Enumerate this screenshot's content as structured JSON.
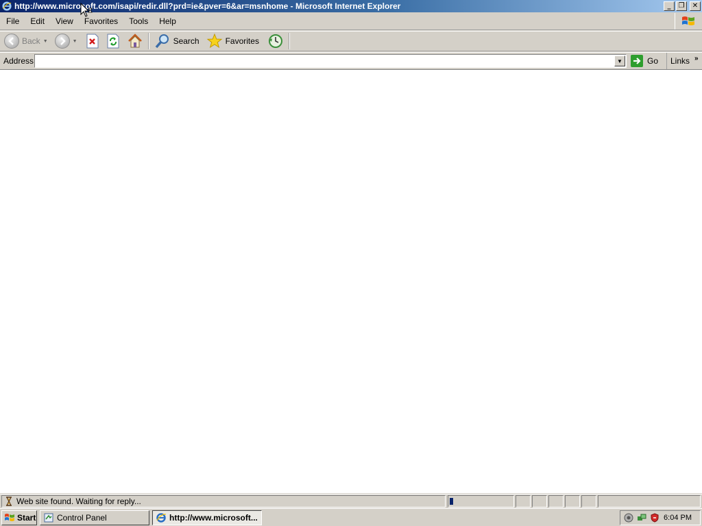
{
  "window": {
    "title": "http://www.microsoft.com/isapi/redir.dll?prd=ie&pver=6&ar=msnhome - Microsoft Internet Explorer",
    "minimize": "_",
    "restore": "❐",
    "close": "✕"
  },
  "menu": {
    "items": [
      "File",
      "Edit",
      "View",
      "Favorites",
      "Tools",
      "Help"
    ]
  },
  "toolbar": {
    "back_label": "Back",
    "search_label": "Search",
    "favorites_label": "Favorites"
  },
  "address": {
    "label": "Address",
    "value": "",
    "go_label": "Go",
    "links_label": "Links",
    "links_more": "»"
  },
  "status": {
    "text": "Web site found. Waiting for reply...",
    "progress_fraction": 0.06
  },
  "taskbar": {
    "start_label": "Start",
    "tasks": [
      {
        "label": "Control Panel",
        "active": false
      },
      {
        "label": "http://www.microsoft...",
        "active": true
      }
    ],
    "clock": "6:04 PM"
  },
  "colors": {
    "title_gradient_start": "#0a246a",
    "title_gradient_end": "#a6caf0",
    "chrome": "#d4d0c8"
  },
  "icons": [
    "ie-icon",
    "windows-logo-icon",
    "back-icon",
    "forward-icon",
    "stop-icon",
    "refresh-icon",
    "home-icon",
    "search-icon",
    "favorites-star-icon",
    "history-icon",
    "go-arrow-icon",
    "hourglass-icon",
    "start-flag-icon",
    "control-panel-icon",
    "security-shield-icon",
    "network-icon",
    "volume-icon"
  ]
}
